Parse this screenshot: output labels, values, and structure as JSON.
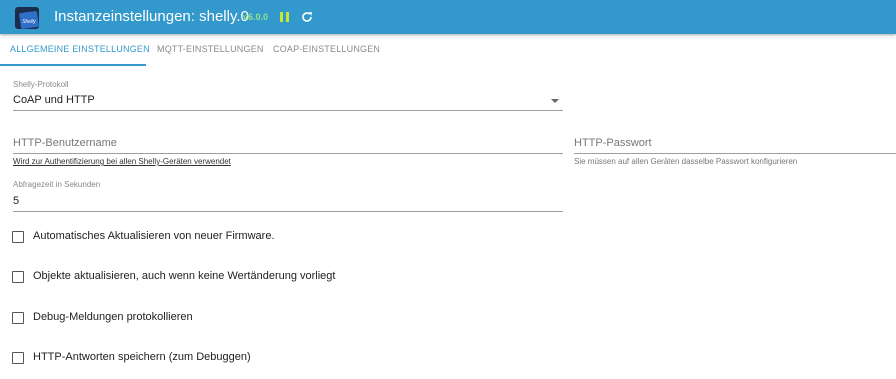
{
  "header": {
    "title": "Instanzeinstellungen: shelly.0",
    "version": "v6.0.0",
    "logo_icon": "shelly-logo-icon",
    "pause_icon": "pause-icon",
    "reload_icon": "reload-icon",
    "bar_color": "#3399cc"
  },
  "tabs": [
    {
      "label": "ALLGEMEINE EINSTELLUNGEN",
      "active": true
    },
    {
      "label": "MQTT-EINSTELLUNGEN",
      "active": false
    },
    {
      "label": "COAP-EINSTELLUNGEN",
      "active": false
    }
  ],
  "protocol": {
    "label": "Shelly-Protokoll",
    "value": "CoAP und HTTP"
  },
  "http_user": {
    "label": "HTTP-Benutzername",
    "helper": "Wird zur Authentifizierung bei allen Shelly-Geräten verwendet"
  },
  "http_password": {
    "label": "HTTP-Passwort",
    "helper": "Sie müssen auf allen Geräten dasselbe Passwort konfigurieren"
  },
  "poll": {
    "label": "Abfragezeit in Sekunden",
    "value": "5"
  },
  "checkboxes": [
    {
      "label": "Automatisches Aktualisieren von neuer Firmware.",
      "checked": false
    },
    {
      "label": "Objekte aktualisieren, auch wenn keine Wertänderung vorliegt",
      "checked": false
    },
    {
      "label": "Debug-Meldungen protokollieren",
      "checked": false
    },
    {
      "label": "HTTP-Antworten speichern (zum Debuggen)",
      "checked": false
    }
  ]
}
